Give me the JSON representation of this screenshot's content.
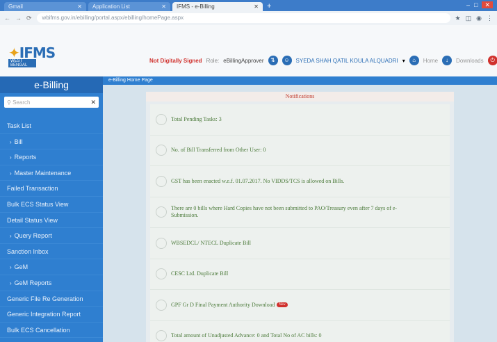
{
  "browser": {
    "tabs": [
      {
        "label": "Gmail",
        "active": false
      },
      {
        "label": "Application List",
        "active": false
      },
      {
        "label": "IFMS - e-Billing",
        "active": true
      }
    ],
    "url": "wbifms.gov.in/ebilling/portal.aspx/ebilling/homePage.aspx"
  },
  "header": {
    "logo_text": "IFMS",
    "logo_sub": "WEST BENGAL",
    "signed_status": "Not Digitally Signed",
    "role_label": "Role:",
    "role": "eBillingApprover",
    "user_name": "SYEDA SHAH QATIL KOULA ALQUADRI",
    "home_label": "Home",
    "download_label": "Downloads"
  },
  "sidebar": {
    "title": "e-Billing",
    "search_placeholder": "Search",
    "items": [
      {
        "label": "Task List",
        "sub": false
      },
      {
        "label": "Bill",
        "sub": true
      },
      {
        "label": "Reports",
        "sub": true
      },
      {
        "label": "Master Maintenance",
        "sub": true
      },
      {
        "label": "Failed Transaction",
        "sub": false
      },
      {
        "label": "Bulk ECS Status View",
        "sub": false
      },
      {
        "label": "Detail Status View",
        "sub": false
      },
      {
        "label": "Query Report",
        "sub": true
      },
      {
        "label": "Sanction Inbox",
        "sub": false
      },
      {
        "label": "GeM",
        "sub": true
      },
      {
        "label": "GeM Reports",
        "sub": true
      },
      {
        "label": "Generic File Re Generation",
        "sub": false
      },
      {
        "label": "Generic Integration Report",
        "sub": false
      },
      {
        "label": "Bulk ECS Cancellation",
        "sub": false
      }
    ]
  },
  "main": {
    "breadcrumb": "e-Billing Home Page",
    "panel_title": "Notifications",
    "notifications": [
      {
        "text": "Total Pending Tasks: 3"
      },
      {
        "text": "No. of Bill Transferred from Other User: 0"
      },
      {
        "text": "GST has been enacted w.e.f. 01.07.2017. No VIDDS/TCS is allowed on Bills."
      },
      {
        "text": "There are 0 bills where Hard Copies have not been submitted to PAO/Treasury even after 7 days of e-Submission."
      },
      {
        "text": "WBSEDCL/ NTECL Duplicate Bill"
      },
      {
        "text": "CESC Ltd. Duplicate Bill"
      },
      {
        "text": "GPF Gr D Final Payment Authority Download",
        "badge": "New"
      },
      {
        "text": "Total amount of Unadjusted Advance: 0 and Total No of AC bills: 0"
      }
    ]
  },
  "colors": {
    "sidebar": "#2f7fd0",
    "accent": "#2a6db5",
    "notification_text": "#4b7a3a",
    "alert": "#d0312d"
  }
}
